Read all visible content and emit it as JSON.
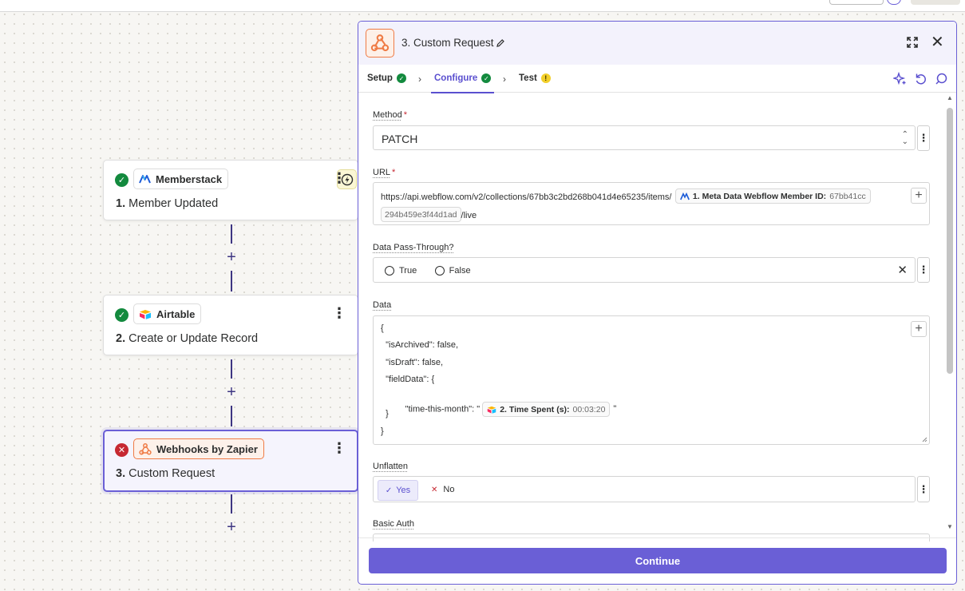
{
  "steps": [
    {
      "app": "Memberstack",
      "number": "1.",
      "title": "Member Updated",
      "status": "ok"
    },
    {
      "app": "Airtable",
      "number": "2.",
      "title": "Create or Update Record",
      "status": "ok"
    },
    {
      "app": "Webhooks by Zapier",
      "number": "3.",
      "title": "Custom Request",
      "status": "error"
    }
  ],
  "panel": {
    "title": "3. Custom Request",
    "tabs": [
      {
        "label": "Setup",
        "state": "ok"
      },
      {
        "label": "Configure",
        "state": "ok"
      },
      {
        "label": "Test",
        "state": "warning"
      }
    ],
    "method": {
      "label": "Method",
      "required": "*",
      "value": "PATCH"
    },
    "url": {
      "label": "URL",
      "required": "*",
      "prefix": "https://api.webflow.com/v2/collections/67bb3c2bd268b041d4e65235/items/",
      "pill_label": "1. Meta Data Webflow Member ID:",
      "pill_value_1": "67bb41cc",
      "pill_value_2": "294b459e3f44d1ad",
      "suffix": "/live"
    },
    "passthrough": {
      "label": "Data Pass-Through?",
      "option_true": "True",
      "option_false": "False"
    },
    "data": {
      "label": "Data",
      "lines": [
        "{",
        "  \"isArchived\": false,",
        "  \"isDraft\": false,",
        "  \"fieldData\": {",
        "    \"time-this-month\": \"",
        "  }",
        "}"
      ],
      "pill_label": "2. Time Spent (s):",
      "pill_value": "00:03:20",
      "pill_close": "\""
    },
    "unflatten": {
      "label": "Unflatten",
      "yes": "Yes",
      "no": "No"
    },
    "basic_auth": {
      "label": "Basic Auth"
    },
    "continue_label": "Continue"
  },
  "colors": {
    "accent": "#6a5fd6",
    "success": "#138a3e",
    "error": "#c62832",
    "webhook": "#ef7b45"
  }
}
